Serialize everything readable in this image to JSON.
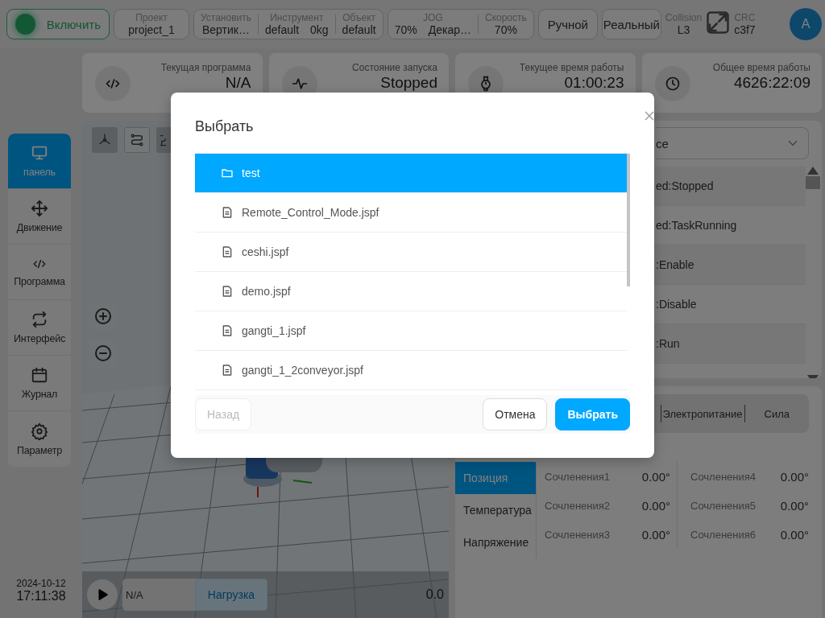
{
  "top_bar": {
    "power": {
      "label": "Включить",
      "on": true
    },
    "project": {
      "label": "Проект",
      "value": "project_1"
    },
    "config_group": [
      {
        "label": "Установить",
        "values": [
          "Вертик…"
        ]
      },
      {
        "label": "Инструмент",
        "values": [
          "default",
          "0kg"
        ]
      },
      {
        "label": "Объект",
        "values": [
          "default"
        ]
      }
    ],
    "jog_group": [
      {
        "label": "JOG",
        "values": [
          "70%",
          "Декар…"
        ]
      },
      {
        "label": "Скорость",
        "values": [
          "70%"
        ]
      }
    ],
    "mode_buttons": [
      "Ручной",
      "Реальный"
    ],
    "collision": {
      "label": "Collision",
      "value": "L3"
    },
    "crc": {
      "label": "CRC",
      "value": "c3f7"
    },
    "avatar": "A"
  },
  "nav": [
    {
      "label": "панель",
      "selected": true
    },
    {
      "label": "Движение",
      "selected": false
    },
    {
      "label": "Программа",
      "selected": false
    },
    {
      "label": "Интерфейс",
      "selected": false
    },
    {
      "label": "Журнал",
      "selected": false
    },
    {
      "label": "Параметр",
      "selected": false
    }
  ],
  "datetime": {
    "date": "2024-10-12",
    "time": "17:11:38"
  },
  "stat_cards": [
    {
      "label": "Текущая программа",
      "value": "N/A"
    },
    {
      "label": "Состояние запуска",
      "value": "Stopped"
    },
    {
      "label": "Текущее время работы",
      "value": "01:00:23"
    },
    {
      "label": "Общее время работы",
      "value": "4626:22:09"
    }
  ],
  "viewport": {
    "program": "N/A",
    "load_button": "Нагрузка",
    "reading": "0.0"
  },
  "log_panel": {
    "dropdown": "ce",
    "rows": [
      "ed:Stopped",
      "ed:TaskRunning",
      ":Enable",
      ":Disable",
      ":Run"
    ]
  },
  "status_panel": {
    "tabs": [
      {
        "label": "Электропитание",
        "selected": false
      },
      {
        "label": "Сила",
        "selected": false
      }
    ],
    "side_tabs": [
      {
        "label": "Позиция",
        "selected": true
      },
      {
        "label": "Температура",
        "selected": false
      },
      {
        "label": "Напряжение",
        "selected": false
      }
    ],
    "joints": [
      {
        "name": "Сочленения1",
        "value": "0.00°"
      },
      {
        "name": "Сочленения2",
        "value": "0.00°"
      },
      {
        "name": "Сочленения3",
        "value": "0.00°"
      },
      {
        "name": "Сочленения4",
        "value": "0.00°"
      },
      {
        "name": "Сочленения5",
        "value": "0.00°"
      },
      {
        "name": "Сочленения6",
        "value": "0.00°"
      }
    ]
  },
  "dialog": {
    "title": "Выбрать",
    "items": [
      {
        "name": "test",
        "kind": "folder",
        "selected": true
      },
      {
        "name": "Remote_Control_Mode.jspf",
        "kind": "file",
        "selected": false
      },
      {
        "name": "ceshi.jspf",
        "kind": "file",
        "selected": false
      },
      {
        "name": "demo.jspf",
        "kind": "file",
        "selected": false
      },
      {
        "name": "gangti_1.jspf",
        "kind": "file",
        "selected": false
      },
      {
        "name": "gangti_1_2conveyor.jspf",
        "kind": "file",
        "selected": false
      }
    ],
    "back_button": {
      "label": "Назад",
      "disabled": true
    },
    "cancel_button": "Отмена",
    "confirm_button": "Выбрать"
  }
}
